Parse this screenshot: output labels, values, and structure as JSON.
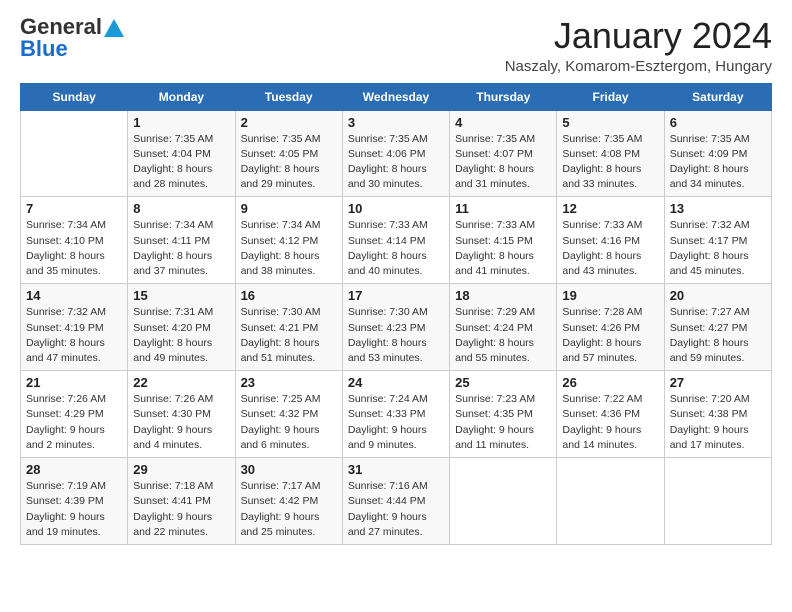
{
  "logo": {
    "general": "General",
    "blue": "Blue"
  },
  "title": "January 2024",
  "location": "Naszaly, Komarom-Esztergom, Hungary",
  "weekdays": [
    "Sunday",
    "Monday",
    "Tuesday",
    "Wednesday",
    "Thursday",
    "Friday",
    "Saturday"
  ],
  "weeks": [
    [
      {
        "day": "",
        "info": ""
      },
      {
        "day": "1",
        "info": "Sunrise: 7:35 AM\nSunset: 4:04 PM\nDaylight: 8 hours\nand 28 minutes."
      },
      {
        "day": "2",
        "info": "Sunrise: 7:35 AM\nSunset: 4:05 PM\nDaylight: 8 hours\nand 29 minutes."
      },
      {
        "day": "3",
        "info": "Sunrise: 7:35 AM\nSunset: 4:06 PM\nDaylight: 8 hours\nand 30 minutes."
      },
      {
        "day": "4",
        "info": "Sunrise: 7:35 AM\nSunset: 4:07 PM\nDaylight: 8 hours\nand 31 minutes."
      },
      {
        "day": "5",
        "info": "Sunrise: 7:35 AM\nSunset: 4:08 PM\nDaylight: 8 hours\nand 33 minutes."
      },
      {
        "day": "6",
        "info": "Sunrise: 7:35 AM\nSunset: 4:09 PM\nDaylight: 8 hours\nand 34 minutes."
      }
    ],
    [
      {
        "day": "7",
        "info": "Sunrise: 7:34 AM\nSunset: 4:10 PM\nDaylight: 8 hours\nand 35 minutes."
      },
      {
        "day": "8",
        "info": "Sunrise: 7:34 AM\nSunset: 4:11 PM\nDaylight: 8 hours\nand 37 minutes."
      },
      {
        "day": "9",
        "info": "Sunrise: 7:34 AM\nSunset: 4:12 PM\nDaylight: 8 hours\nand 38 minutes."
      },
      {
        "day": "10",
        "info": "Sunrise: 7:33 AM\nSunset: 4:14 PM\nDaylight: 8 hours\nand 40 minutes."
      },
      {
        "day": "11",
        "info": "Sunrise: 7:33 AM\nSunset: 4:15 PM\nDaylight: 8 hours\nand 41 minutes."
      },
      {
        "day": "12",
        "info": "Sunrise: 7:33 AM\nSunset: 4:16 PM\nDaylight: 8 hours\nand 43 minutes."
      },
      {
        "day": "13",
        "info": "Sunrise: 7:32 AM\nSunset: 4:17 PM\nDaylight: 8 hours\nand 45 minutes."
      }
    ],
    [
      {
        "day": "14",
        "info": "Sunrise: 7:32 AM\nSunset: 4:19 PM\nDaylight: 8 hours\nand 47 minutes."
      },
      {
        "day": "15",
        "info": "Sunrise: 7:31 AM\nSunset: 4:20 PM\nDaylight: 8 hours\nand 49 minutes."
      },
      {
        "day": "16",
        "info": "Sunrise: 7:30 AM\nSunset: 4:21 PM\nDaylight: 8 hours\nand 51 minutes."
      },
      {
        "day": "17",
        "info": "Sunrise: 7:30 AM\nSunset: 4:23 PM\nDaylight: 8 hours\nand 53 minutes."
      },
      {
        "day": "18",
        "info": "Sunrise: 7:29 AM\nSunset: 4:24 PM\nDaylight: 8 hours\nand 55 minutes."
      },
      {
        "day": "19",
        "info": "Sunrise: 7:28 AM\nSunset: 4:26 PM\nDaylight: 8 hours\nand 57 minutes."
      },
      {
        "day": "20",
        "info": "Sunrise: 7:27 AM\nSunset: 4:27 PM\nDaylight: 8 hours\nand 59 minutes."
      }
    ],
    [
      {
        "day": "21",
        "info": "Sunrise: 7:26 AM\nSunset: 4:29 PM\nDaylight: 9 hours\nand 2 minutes."
      },
      {
        "day": "22",
        "info": "Sunrise: 7:26 AM\nSunset: 4:30 PM\nDaylight: 9 hours\nand 4 minutes."
      },
      {
        "day": "23",
        "info": "Sunrise: 7:25 AM\nSunset: 4:32 PM\nDaylight: 9 hours\nand 6 minutes."
      },
      {
        "day": "24",
        "info": "Sunrise: 7:24 AM\nSunset: 4:33 PM\nDaylight: 9 hours\nand 9 minutes."
      },
      {
        "day": "25",
        "info": "Sunrise: 7:23 AM\nSunset: 4:35 PM\nDaylight: 9 hours\nand 11 minutes."
      },
      {
        "day": "26",
        "info": "Sunrise: 7:22 AM\nSunset: 4:36 PM\nDaylight: 9 hours\nand 14 minutes."
      },
      {
        "day": "27",
        "info": "Sunrise: 7:20 AM\nSunset: 4:38 PM\nDaylight: 9 hours\nand 17 minutes."
      }
    ],
    [
      {
        "day": "28",
        "info": "Sunrise: 7:19 AM\nSunset: 4:39 PM\nDaylight: 9 hours\nand 19 minutes."
      },
      {
        "day": "29",
        "info": "Sunrise: 7:18 AM\nSunset: 4:41 PM\nDaylight: 9 hours\nand 22 minutes."
      },
      {
        "day": "30",
        "info": "Sunrise: 7:17 AM\nSunset: 4:42 PM\nDaylight: 9 hours\nand 25 minutes."
      },
      {
        "day": "31",
        "info": "Sunrise: 7:16 AM\nSunset: 4:44 PM\nDaylight: 9 hours\nand 27 minutes."
      },
      {
        "day": "",
        "info": ""
      },
      {
        "day": "",
        "info": ""
      },
      {
        "day": "",
        "info": ""
      }
    ]
  ]
}
